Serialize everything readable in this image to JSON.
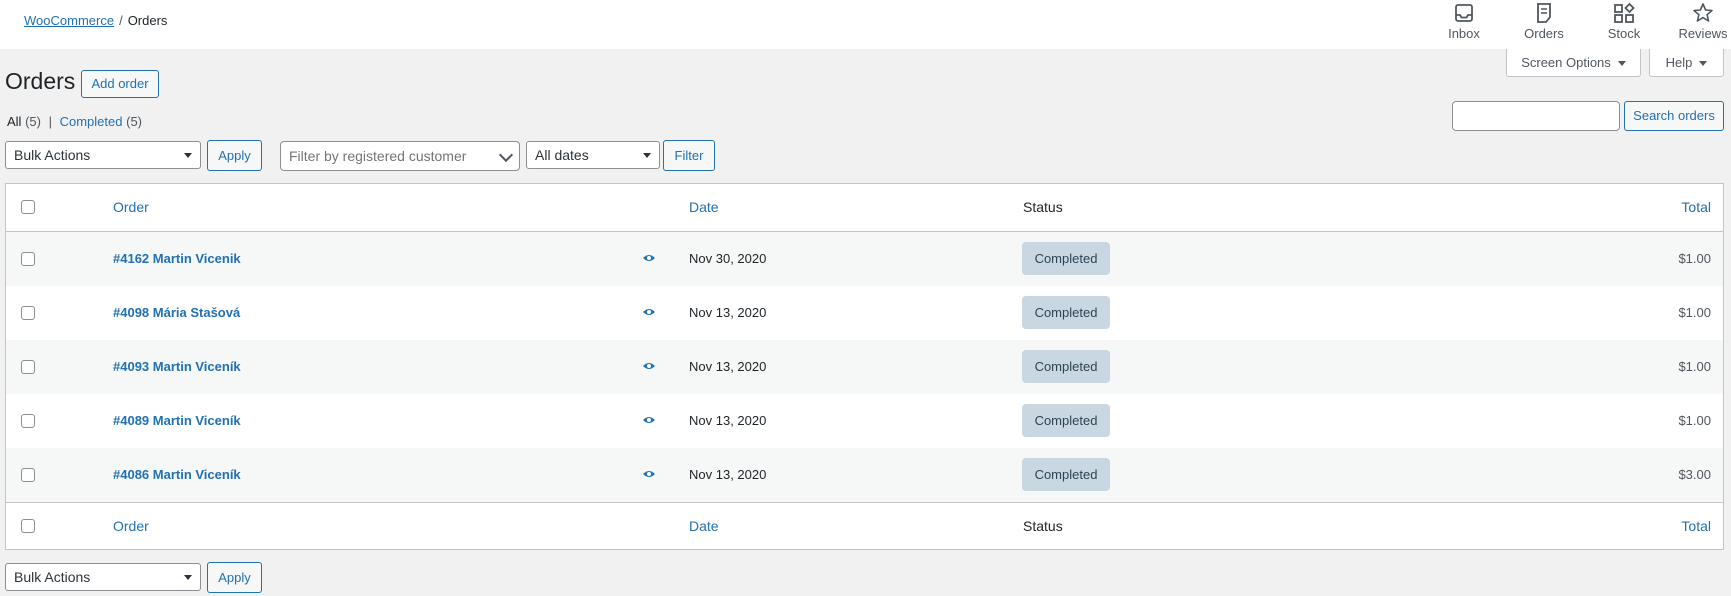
{
  "breadcrumb": {
    "root": "WooCommerce",
    "separator": "/",
    "current": "Orders"
  },
  "activity": [
    {
      "label": "Inbox",
      "icon": "inbox-icon"
    },
    {
      "label": "Orders",
      "icon": "orders-icon"
    },
    {
      "label": "Stock",
      "icon": "stock-icon"
    },
    {
      "label": "Reviews",
      "icon": "star-icon"
    }
  ],
  "screen_options": "Screen Options",
  "help": "Help",
  "page_title": "Orders",
  "add_order": "Add order",
  "filters_views": {
    "all_label": "All",
    "all_count": "(5)",
    "separator": "|",
    "completed_label": "Completed",
    "completed_count": "(5)"
  },
  "search_button": "Search orders",
  "bulk_actions": "Bulk Actions",
  "apply": "Apply",
  "customer_placeholder": "Filter by registered customer",
  "all_dates": "All dates",
  "filter": "Filter",
  "columns": {
    "order": "Order",
    "date": "Date",
    "status": "Status",
    "total": "Total"
  },
  "orders": [
    {
      "order": "#4162 Martin Vicenik",
      "date": "Nov 30, 2020",
      "status": "Completed",
      "total": "$1.00"
    },
    {
      "order": "#4098 Mária Stašová",
      "date": "Nov 13, 2020",
      "status": "Completed",
      "total": "$1.00"
    },
    {
      "order": "#4093 Martin Viceník",
      "date": "Nov 13, 2020",
      "status": "Completed",
      "total": "$1.00"
    },
    {
      "order": "#4089 Martin Viceník",
      "date": "Nov 13, 2020",
      "status": "Completed",
      "total": "$1.00"
    },
    {
      "order": "#4086 Martin Viceník",
      "date": "Nov 13, 2020",
      "status": "Completed",
      "total": "$3.00"
    }
  ],
  "colors": {
    "link": "#2271b1",
    "badge_bg": "#c8d7e1",
    "badge_text": "#2e4453"
  }
}
